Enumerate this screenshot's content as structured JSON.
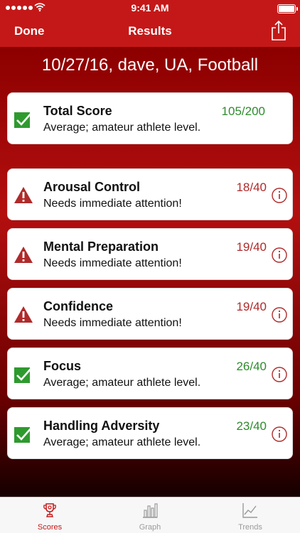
{
  "status_bar": {
    "time": "9:41 AM",
    "battery_level": 1.0
  },
  "nav": {
    "done_label": "Done",
    "title": "Results"
  },
  "header": {
    "text": "10/27/16, dave, UA, Football"
  },
  "total": {
    "name": "Total Score",
    "score": "105/200",
    "description": "Average; amateur athlete level.",
    "status": "good"
  },
  "categories": [
    {
      "name": "Arousal Control",
      "score": "18/40",
      "description": "Needs immediate attention!",
      "status": "warning"
    },
    {
      "name": "Mental Preparation",
      "score": "19/40",
      "description": "Needs immediate attention!",
      "status": "warning"
    },
    {
      "name": "Confidence",
      "score": "19/40",
      "description": "Needs immediate attention!",
      "status": "warning"
    },
    {
      "name": "Focus",
      "score": "26/40",
      "description": "Average; amateur athlete level.",
      "status": "good"
    },
    {
      "name": "Handling Adversity",
      "score": "23/40",
      "description": "Average; amateur athlete level.",
      "status": "good"
    }
  ],
  "tabs": [
    {
      "label": "Scores",
      "icon": "trophy-icon",
      "active": true
    },
    {
      "label": "Graph",
      "icon": "bar-chart-icon",
      "active": false
    },
    {
      "label": "Trends",
      "icon": "trend-line-icon",
      "active": false
    }
  ],
  "colors": {
    "brand_red": "#c41818",
    "good_green": "#2e8b2e",
    "warning_red": "#b02a2a"
  }
}
